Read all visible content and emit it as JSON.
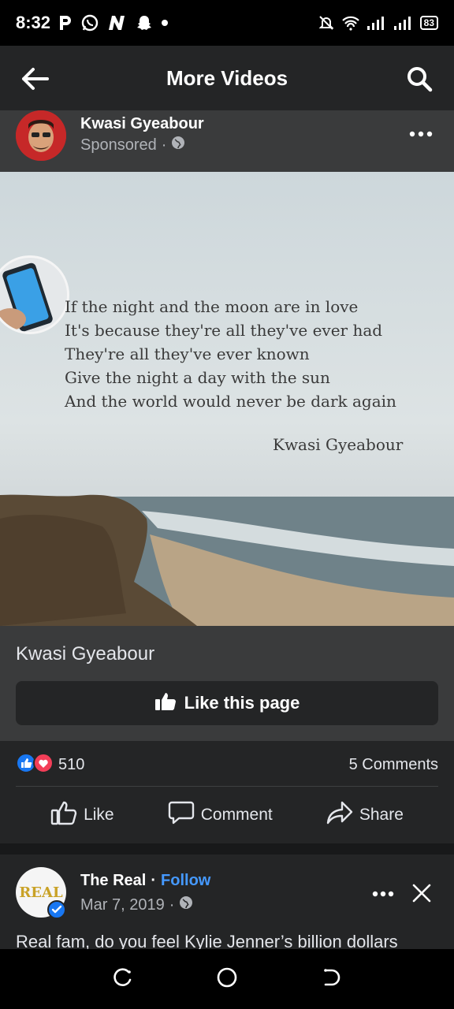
{
  "status_bar": {
    "time": "8:32",
    "notification_icons": [
      "p-app-icon",
      "whatsapp-icon",
      "n-app-icon",
      "snapchat-icon",
      "dot-icon"
    ],
    "battery": "83"
  },
  "appbar": {
    "title": "More Videos"
  },
  "post": {
    "author": "Kwasi Gyeabour",
    "sponsored": "Sponsored",
    "separator": "·",
    "poem_lines": [
      "If the night and the moon are in love",
      "It's because they're all they've ever had",
      "They're all they've ever known",
      "Give the night a day with the sun",
      "And the world would never be dark again"
    ],
    "signature": "Kwasi Gyeabour",
    "caption": "Kwasi Gyeabour",
    "like_page_label": "Like this page",
    "reaction_count": "510",
    "comments_count": "5 Comments",
    "actions": {
      "like": "Like",
      "comment": "Comment",
      "share": "Share"
    }
  },
  "next_post": {
    "page_name": "The Real",
    "separator": "·",
    "follow_label": "Follow",
    "date": "Mar 7, 2019",
    "avatar_text": "REAL",
    "text": "Real fam, do you feel Kylie Jenner’s billion dollars"
  },
  "colors": {
    "appbar_bg": "#242526",
    "card_bg": "#3a3b3c",
    "accent_blue": "#4599ff",
    "like_blue": "#1877f2",
    "love_red": "#f33e58"
  }
}
